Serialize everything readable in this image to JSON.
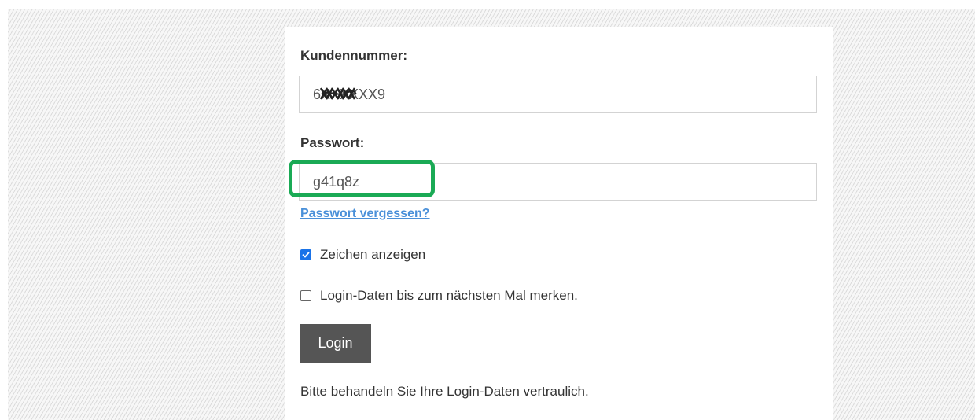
{
  "form": {
    "customer_number_label": "Kundennummer:",
    "customer_number_value": "6XXXXXX9",
    "password_label": "Passwort:",
    "password_value": "g41q8z",
    "forgot_password_link": "Passwort vergessen?",
    "show_chars_label": "Zeichen anzeigen",
    "show_chars_checked": true,
    "remember_label": "Login-Daten bis zum nächsten Mal merken.",
    "remember_checked": false,
    "login_button": "Login",
    "note": "Bitte behandeln Sie Ihre Login-Daten vertraulich."
  },
  "colors": {
    "highlight": "#1aaa55",
    "link": "#4a90d9",
    "checkbox_accent": "#1a73e8",
    "button_bg": "#555555"
  },
  "icons": {
    "redaction": "scribble-redaction-icon",
    "checkmark": "checkmark-icon"
  }
}
